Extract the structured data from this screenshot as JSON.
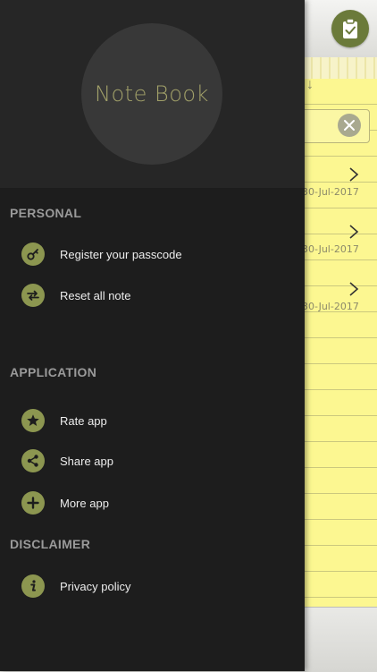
{
  "app": {
    "icons": {
      "clipboard": "clipboard-check-icon",
      "sort": "arrow-down-icon",
      "clear": "close-icon",
      "chevron": "chevron-right-icon"
    },
    "sort_arrow": "↓",
    "notes": [
      {
        "date": "30-Jul-2017"
      },
      {
        "date": "30-Jul-2017"
      },
      {
        "date": "30-Jul-2017"
      }
    ]
  },
  "drawer": {
    "logo_text": "Note Book",
    "sections": {
      "personal": {
        "title": "PERSONAL",
        "items": [
          {
            "label": "Register your passcode",
            "icon": "key-icon"
          },
          {
            "label": "Reset all note",
            "icon": "reset-icon"
          }
        ]
      },
      "application": {
        "title": "APPLICATION",
        "items": [
          {
            "label": "Rate app",
            "icon": "star-icon"
          },
          {
            "label": "Share app",
            "icon": "share-icon"
          },
          {
            "label": "More app",
            "icon": "plus-icon"
          }
        ]
      },
      "disclaimer": {
        "title": "DISCLAIMER",
        "items": [
          {
            "label": "Privacy policy",
            "icon": "info-icon"
          }
        ]
      }
    }
  },
  "colors": {
    "drawer_bg": "#1d1d1d",
    "drawer_header_bg": "#262626",
    "icon_accent": "#8c9650",
    "logo_text": "#a1a069",
    "paper": "#fcf791"
  }
}
